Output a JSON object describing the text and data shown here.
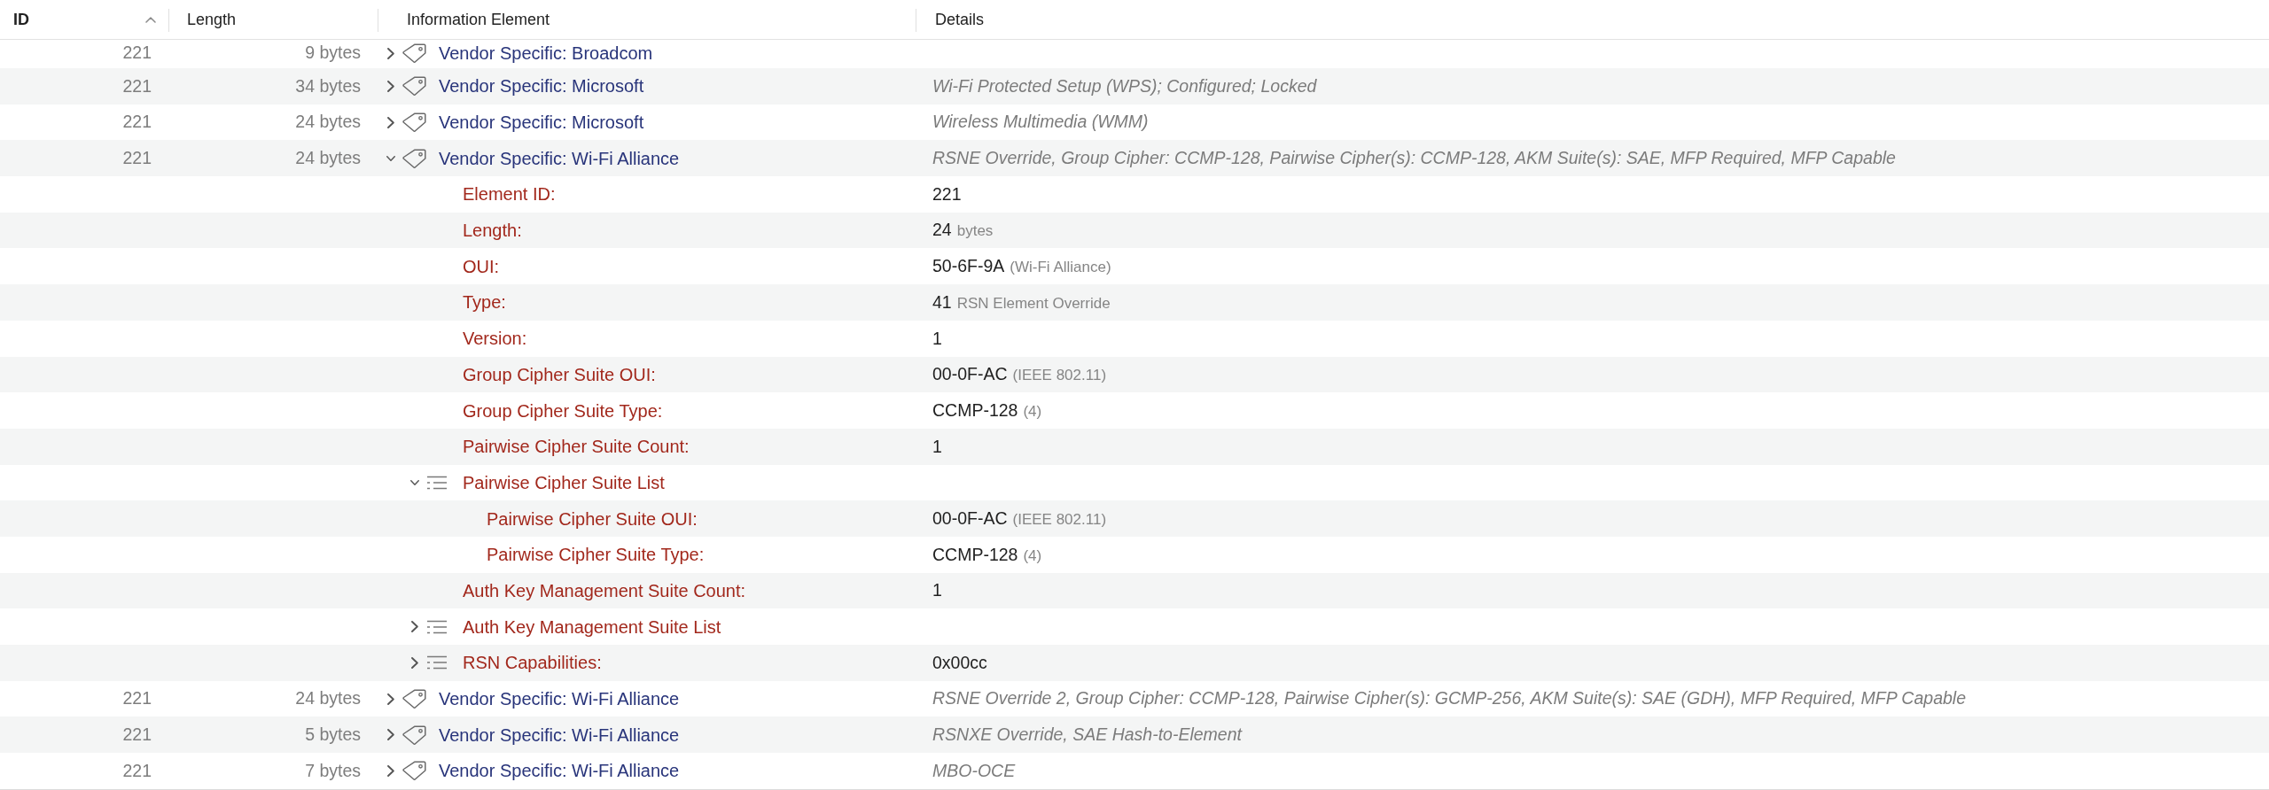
{
  "columns": [
    {
      "label": "ID",
      "sorted": true
    },
    {
      "label": "Length",
      "sorted": false
    },
    {
      "label": "Information Element",
      "sorted": false
    },
    {
      "label": "Details",
      "sorted": false
    }
  ],
  "elements": [
    {
      "kind": "element",
      "id": "221",
      "length": "9 bytes",
      "name": "Vendor Specific: Broadcom",
      "expanded": false
    },
    {
      "kind": "element",
      "id": "221",
      "length": "34 bytes",
      "name": "Vendor Specific: Microsoft",
      "expanded": false,
      "details": "Wi-Fi Protected Setup (WPS); Configured; Locked"
    },
    {
      "kind": "element",
      "id": "221",
      "length": "24 bytes",
      "name": "Vendor Specific: Microsoft",
      "expanded": false,
      "details": "Wireless Multimedia (WMM)"
    },
    {
      "kind": "element",
      "id": "221",
      "length": "24 bytes",
      "name": "Vendor Specific: Wi-Fi Alliance",
      "expanded": true,
      "details": "RSNE Override, Group Cipher: CCMP-128, Pairwise Cipher(s): CCMP-128, AKM Suite(s): SAE, MFP Required, MFP Capable",
      "children": [
        {
          "kind": "field",
          "name": "Element ID:",
          "value": "221"
        },
        {
          "kind": "field",
          "name": "Length:",
          "value": "24",
          "note": "bytes"
        },
        {
          "kind": "field",
          "name": "OUI:",
          "value": "50-6F-9A",
          "note": "(Wi-Fi Alliance)"
        },
        {
          "kind": "field",
          "name": "Type:",
          "value": "41",
          "note": "RSN Element Override"
        },
        {
          "kind": "field",
          "name": "Version:",
          "value": "1"
        },
        {
          "kind": "field",
          "name": "Group Cipher Suite OUI:",
          "value": "00-0F-AC",
          "note": "(IEEE 802.11)"
        },
        {
          "kind": "field",
          "name": "Group Cipher Suite Type:",
          "value": "CCMP-128",
          "note": "(4)"
        },
        {
          "kind": "field",
          "name": "Pairwise Cipher Suite Count:",
          "value": "1"
        },
        {
          "kind": "group",
          "name": "Pairwise Cipher Suite List",
          "expanded": true,
          "children": [
            {
              "kind": "field",
              "name": "Pairwise Cipher Suite OUI:",
              "value": "00-0F-AC",
              "note": "(IEEE 802.11)"
            },
            {
              "kind": "field",
              "name": "Pairwise Cipher Suite Type:",
              "value": "CCMP-128",
              "note": "(4)"
            }
          ]
        },
        {
          "kind": "field",
          "name": "Auth Key Management Suite Count:",
          "value": "1"
        },
        {
          "kind": "group",
          "name": "Auth Key Management Suite List",
          "expanded": false
        },
        {
          "kind": "group",
          "name": "RSN Capabilities:",
          "expanded": false,
          "value": "0x00cc"
        }
      ]
    },
    {
      "kind": "element",
      "id": "221",
      "length": "24 bytes",
      "name": "Vendor Specific: Wi-Fi Alliance",
      "expanded": false,
      "details": "RSNE Override 2, Group Cipher: CCMP-128, Pairwise Cipher(s): GCMP-256, AKM Suite(s): SAE (GDH), MFP Required, MFP Capable"
    },
    {
      "kind": "element",
      "id": "221",
      "length": "5 bytes",
      "name": "Vendor Specific: Wi-Fi Alliance",
      "expanded": false,
      "details": "RSNXE Override, SAE Hash-to-Element"
    },
    {
      "kind": "element",
      "id": "221",
      "length": "7 bytes",
      "name": "Vendor Specific: Wi-Fi Alliance",
      "expanded": false,
      "details": "MBO-OCE"
    }
  ]
}
